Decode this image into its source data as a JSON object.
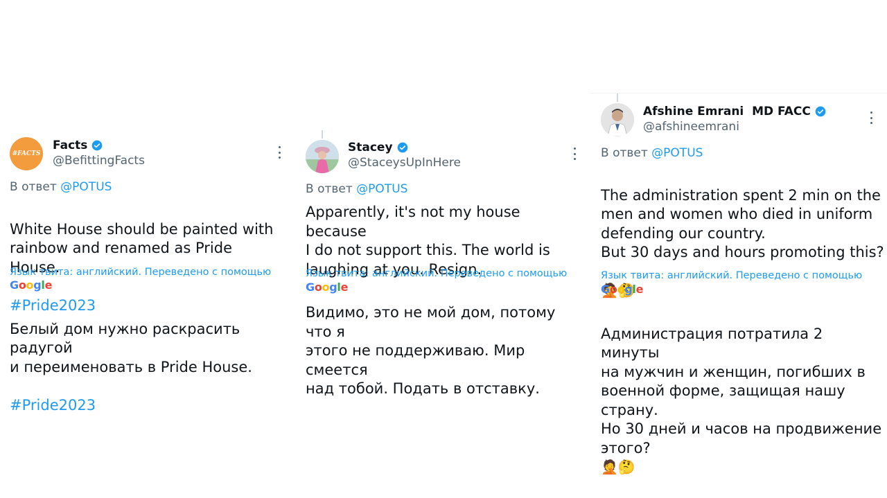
{
  "tweets": [
    {
      "name": "Facts",
      "handle": "@BefittingFacts",
      "avatar_text": "#FACTS",
      "reply_prefix": "В ответ",
      "reply_to": "@POTUS",
      "text_main": "White House should be painted with\nrainbow and renamed as Pride House.",
      "text_hashtag": "#Pride2023",
      "translate_note": "Язык твита: английский. Переведено с помощью",
      "translated_main": "Белый дом нужно раскрасить радугой\nи переименовать в Pride House.",
      "translated_hashtag": "#Pride2023"
    },
    {
      "name": "Stacey",
      "handle": "@StaceysUpInHere",
      "reply_prefix": "В ответ",
      "reply_to": "@POTUS",
      "text_main": "Apparently, it's not my house because\nI do not support this. The world is\nlaughing at you. Resign.",
      "translate_note": "Язык твита: английский. Переведено с помощью",
      "translated_main": "Видимо, это не мой дом, потому что я\nэтого не поддерживаю. Мир смеется\nнад тобой. Подать в отставку."
    },
    {
      "name": "Afshine Emrani  MD FACC",
      "handle": "@afshineemrani",
      "reply_prefix": "В ответ",
      "reply_to": "@POTUS",
      "text_main": "The administration spent 2 min on the\nmen and women who died in uniform\ndefending our country.\nBut 30 days and hours promoting this?",
      "text_emoji": "🤦🤔",
      "translate_note": "Язык твита: английский. Переведено с помощью",
      "translated_main": "Администрация потратила 2 минуты\nна мужчин и женщин, погибших в\nвоенной форме, защищая нашу страну.\nНо 30 дней и часов на продвижение\nэтого?",
      "translated_emoji": "🤦🤔"
    }
  ],
  "google": {
    "g1": "G",
    "o1": "o",
    "o2": "o",
    "g2": "g",
    "l": "l",
    "e": "e"
  },
  "colors": {
    "link": "#1d9bf0",
    "secondary": "#536471",
    "text": "#0f1419",
    "avatar_facts": "#f39c3d"
  }
}
